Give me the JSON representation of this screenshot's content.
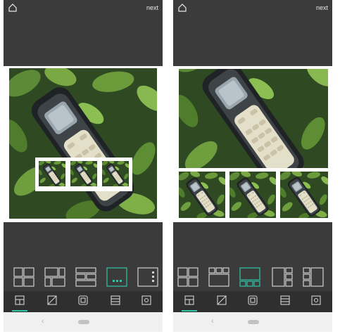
{
  "screens": [
    {
      "top_bar": {
        "home_icon": "home-icon",
        "next_label": "next"
      },
      "layout_options": [
        "layout-2x2",
        "layout-2x2-split",
        "layout-rows",
        "layout-big-3-bottom",
        "layout-big-right-3"
      ],
      "selected_layout_index": 3,
      "tabs": [
        "layout-icon",
        "ratio-icon",
        "border-icon",
        "rows-icon",
        "settings-icon"
      ],
      "selected_tab_index": 0,
      "nav": {
        "back_glyph": "‹"
      }
    },
    {
      "top_bar": {
        "home_icon": "home-icon",
        "next_label": "next"
      },
      "layout_options": [
        "layout-2x2",
        "layout-3-top-1-bottom",
        "layout-big-3-bottom",
        "layout-big-left-3",
        "layout-3-left-big"
      ],
      "selected_layout_index": 2,
      "tabs": [
        "layout-icon",
        "ratio-icon",
        "border-icon",
        "rows-icon",
        "settings-icon"
      ],
      "selected_tab_index": 0,
      "nav": {
        "back_glyph": "‹"
      }
    }
  ],
  "colors": {
    "accent": "#2ec4a5",
    "panel": "#3b3b3b",
    "tabbar": "#2f2f2f",
    "icon": "#d0d0d0"
  }
}
